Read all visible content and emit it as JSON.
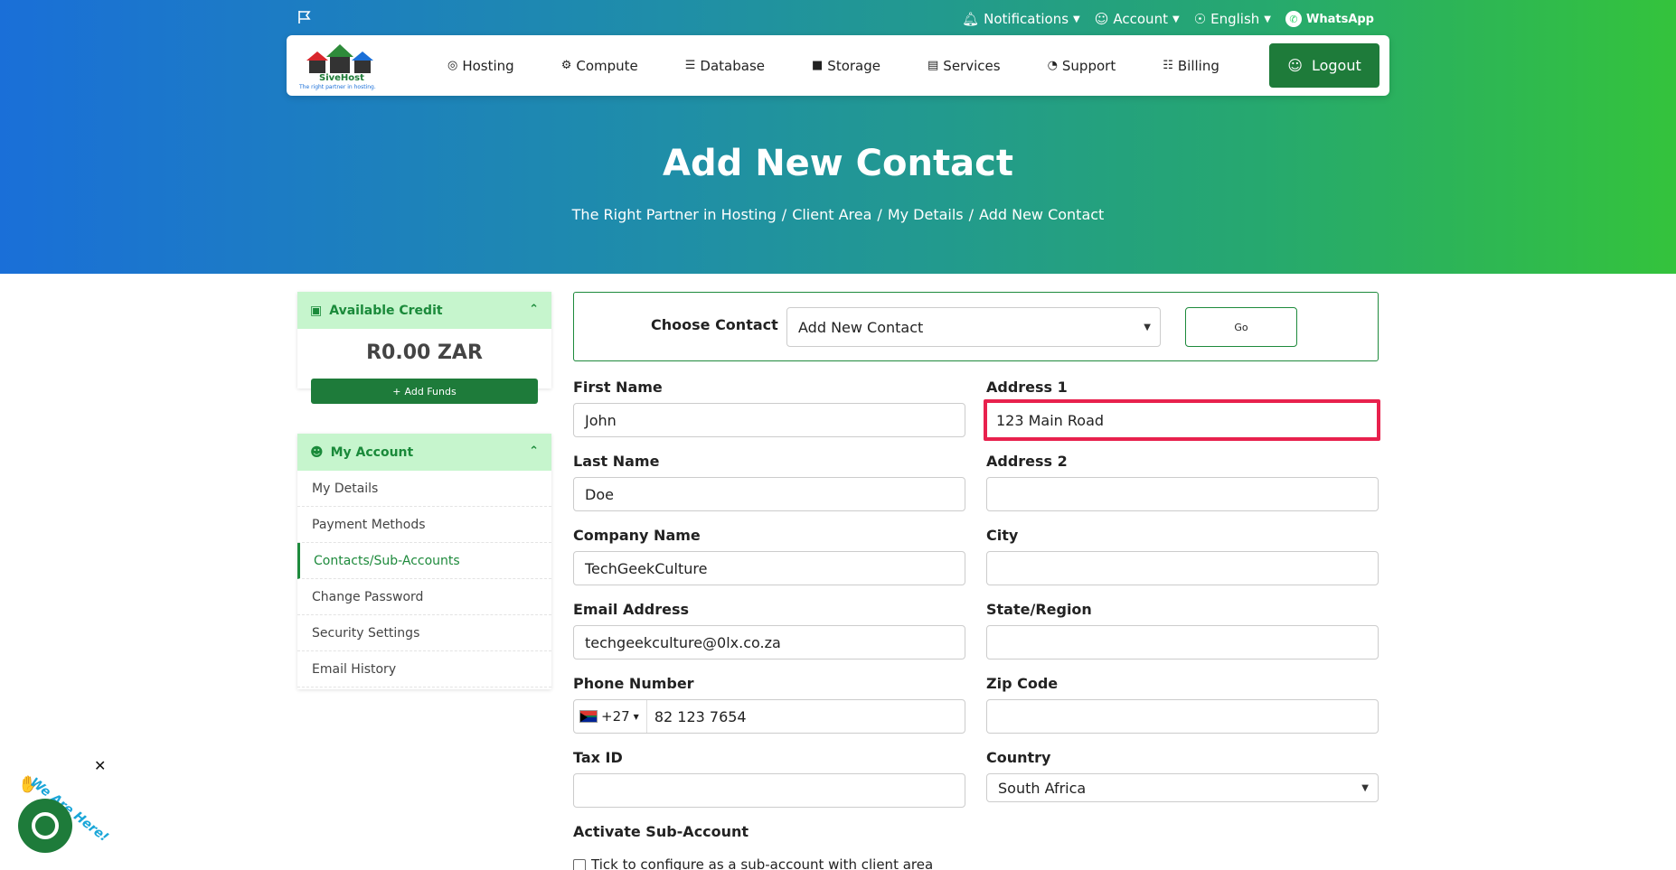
{
  "topbar": {
    "notifications": "Notifications",
    "account": "Account",
    "language": "English",
    "whatsapp": "WhatsApp"
  },
  "logo": {
    "name": "SiveHost",
    "tagline": "The right partner in hosting."
  },
  "nav": {
    "items": [
      {
        "label": "Hosting",
        "icon": "globe-icon"
      },
      {
        "label": "Compute",
        "icon": "gear-icon"
      },
      {
        "label": "Database",
        "icon": "database-icon"
      },
      {
        "label": "Storage",
        "icon": "box-icon"
      },
      {
        "label": "Services",
        "icon": "gift-icon"
      },
      {
        "label": "Support",
        "icon": "headset-icon"
      },
      {
        "label": "Billing",
        "icon": "document-icon"
      }
    ],
    "logout": "Logout"
  },
  "hero": {
    "title": "Add New Contact",
    "breadcrumb": [
      "The Right Partner in Hosting",
      "Client Area",
      "My Details",
      "Add New Contact"
    ]
  },
  "sidebar": {
    "credit": {
      "title": "Available Credit",
      "amount": "R0.00 ZAR",
      "add_funds": "Add Funds"
    },
    "account": {
      "title": "My Account",
      "items": [
        "My Details",
        "Payment Methods",
        "Contacts/Sub-Accounts",
        "Change Password",
        "Security Settings",
        "Email History"
      ],
      "active_index": 2
    }
  },
  "form": {
    "choose_label": "Choose Contact",
    "choose_value": "Add New Contact",
    "go": "Go",
    "first_name": {
      "label": "First Name",
      "value": "John"
    },
    "last_name": {
      "label": "Last Name",
      "value": "Doe"
    },
    "company": {
      "label": "Company Name",
      "value": "TechGeekCulture"
    },
    "email": {
      "label": "Email Address",
      "value": "techgeekculture@0lx.co.za"
    },
    "phone": {
      "label": "Phone Number",
      "code": "+27",
      "value": "82 123 7654"
    },
    "tax_id": {
      "label": "Tax ID",
      "value": ""
    },
    "address1": {
      "label": "Address 1",
      "value": "123 Main Road"
    },
    "address2": {
      "label": "Address 2",
      "value": ""
    },
    "city": {
      "label": "City",
      "value": ""
    },
    "state": {
      "label": "State/Region",
      "value": ""
    },
    "zip": {
      "label": "Zip Code",
      "value": ""
    },
    "country": {
      "label": "Country",
      "value": "South Africa"
    },
    "activate": {
      "label": "Activate Sub-Account",
      "checkbox_text": "Tick to configure as a sub-account with client area"
    }
  },
  "chat": {
    "text": "We Are Here!"
  },
  "colors": {
    "accent": "#1e7b3a",
    "highlight": "#e8214d",
    "panel_head": "#c6f5cd"
  }
}
